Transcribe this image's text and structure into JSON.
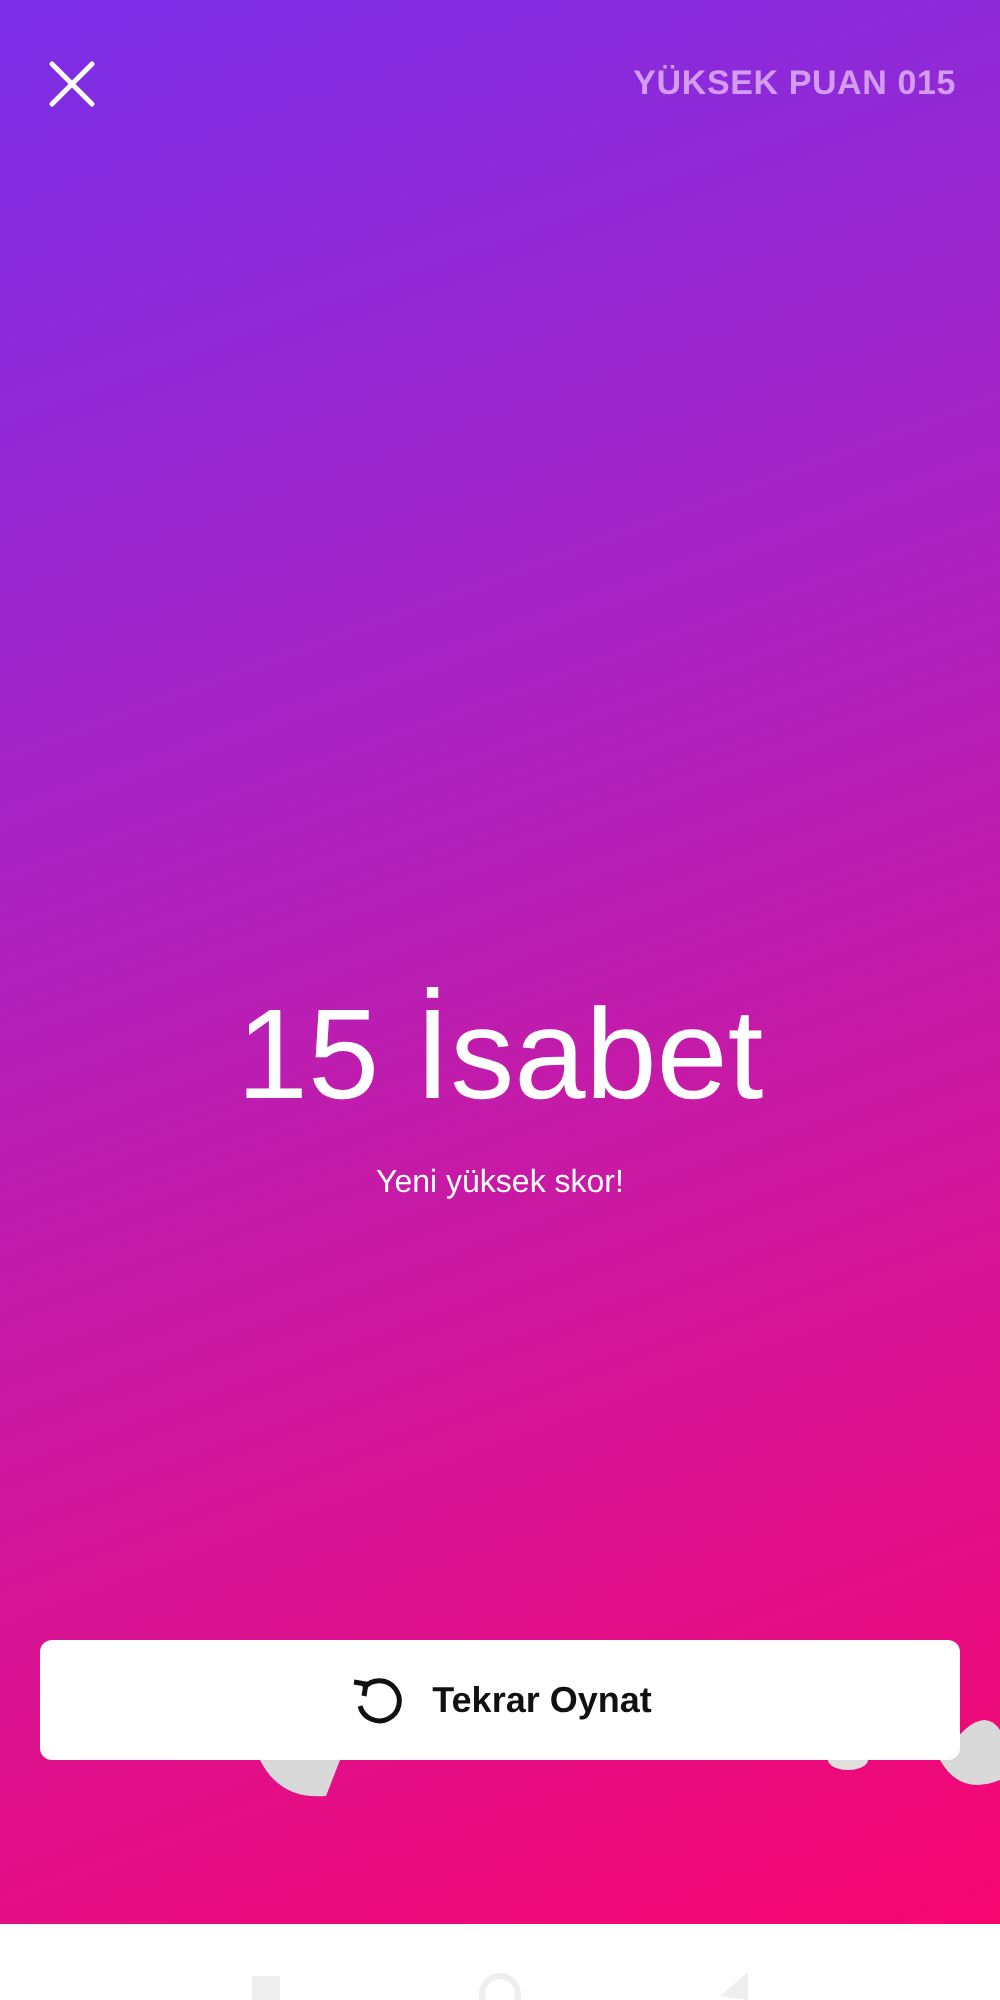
{
  "header": {
    "high_score": "YÜKSEK PUAN 015"
  },
  "result": {
    "score": "15 İsabet",
    "message": "Yeni yüksek skor!"
  },
  "button": {
    "label": "Tekrar Oynat"
  }
}
